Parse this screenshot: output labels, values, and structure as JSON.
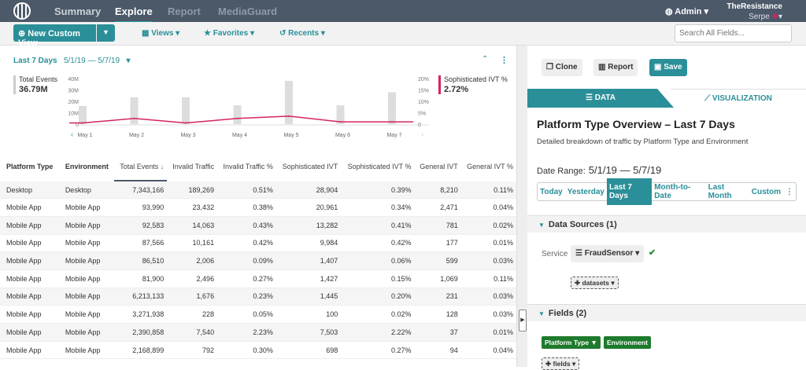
{
  "nav": {
    "items": [
      "Summary",
      "Explore",
      "Report",
      "MediaGuard"
    ],
    "active": "Explore",
    "user": "Admin",
    "org": "TheResistance",
    "sub_user": "Serpe"
  },
  "toolbar": {
    "new_view": "New Custom View",
    "views": "Views",
    "favorites": "Favorites",
    "recents": "Recents",
    "search_placeholder": "Search All Fields..."
  },
  "date": {
    "preset": "Last 7 Days",
    "range": "5/1/19 — 5/7/19"
  },
  "stats": {
    "total_label": "Total Events",
    "total_value": "36.79M",
    "ivt_label": "Sophisticated IVT %",
    "ivt_value": "2.72%"
  },
  "colors": {
    "accent": "#2a8f98",
    "line": "#d6245b",
    "bar": "#dddddd",
    "nav_bg": "#4b5969",
    "chip": "#1e7a2c"
  },
  "chart_data": {
    "type": "bar+line",
    "categories": [
      "May 1",
      "May 2",
      "May 3",
      "May 4",
      "May 5",
      "May 6",
      "May 7"
    ],
    "series": [
      {
        "name": "Total Events",
        "type": "bar",
        "axis": "left",
        "values": [
          16000000,
          23500000,
          23500000,
          16500000,
          38000000,
          16500000,
          28000000
        ]
      },
      {
        "name": "Sophisticated IVT %",
        "type": "line",
        "axis": "right",
        "values": [
          0.5,
          2.5,
          0.5,
          2.5,
          3.5,
          1,
          1
        ]
      }
    ],
    "left_ticks": [
      "0",
      "10M",
      "20M",
      "30M",
      "40M"
    ],
    "right_ticks": [
      "0",
      "5%",
      "10%",
      "15%",
      "20%"
    ],
    "ylim_left": [
      0,
      40000000
    ],
    "ylim_right": [
      0,
      20
    ]
  },
  "table": {
    "columns": [
      "Platform Type",
      "Environment",
      "Total Events",
      "Invalid Traffic",
      "Invalid Traffic %",
      "Sophisticated IVT",
      "Sophisticated IVT %",
      "General IVT",
      "General IVT %"
    ],
    "rows": [
      [
        "Desktop",
        "Desktop",
        "7,343,166",
        "189,269",
        "0.51%",
        "28,904",
        "0.39%",
        "8,210",
        "0.11%"
      ],
      [
        "Mobile App",
        "Mobile App",
        "93,990",
        "23,432",
        "0.38%",
        "20,961",
        "0.34%",
        "2,471",
        "0.04%"
      ],
      [
        "Mobile App",
        "Mobile App",
        "92,583",
        "14,063",
        "0.43%",
        "13,282",
        "0.41%",
        "781",
        "0.02%"
      ],
      [
        "Mobile App",
        "Mobile App",
        "87,566",
        "10,161",
        "0.42%",
        "9,984",
        "0.42%",
        "177",
        "0.01%"
      ],
      [
        "Mobile App",
        "Mobile App",
        "86,510",
        "2,006",
        "0.09%",
        "1,407",
        "0.06%",
        "599",
        "0.03%"
      ],
      [
        "Mobile App",
        "Mobile App",
        "81,900",
        "2,496",
        "0.27%",
        "1,427",
        "0.15%",
        "1,069",
        "0.11%"
      ],
      [
        "Mobile App",
        "Mobile App",
        "6,213,133",
        "1,676",
        "0.23%",
        "1,445",
        "0.20%",
        "231",
        "0.03%"
      ],
      [
        "Mobile App",
        "Mobile App",
        "3,271,938",
        "228",
        "0.05%",
        "100",
        "0.02%",
        "128",
        "0.03%"
      ],
      [
        "Mobile App",
        "Mobile App",
        "2,390,858",
        "7,540",
        "2.23%",
        "7,503",
        "2.22%",
        "37",
        "0.01%"
      ],
      [
        "Mobile App",
        "Mobile App",
        "2,168,899",
        "792",
        "0.30%",
        "698",
        "0.27%",
        "94",
        "0.04%"
      ]
    ]
  },
  "panel": {
    "clone": "Clone",
    "report": "Report",
    "save": "Save",
    "tab_data": "DATA",
    "tab_vis": "VISUALIZATION",
    "title": "Platform Type Overview – Last 7 Days",
    "description": "Detailed breakdown of traffic by Platform Type and Environment",
    "date_label": "Date Range:",
    "date_value": "5/1/19 — 5/7/19",
    "presets": [
      "Today",
      "Yesterday",
      "Last 7 Days",
      "Month-to-Date",
      "Last Month",
      "Custom"
    ],
    "active_preset": "Last 7 Days",
    "sources_header": "Data Sources (1)",
    "service_label": "Service",
    "service_value": "FraudSensor",
    "datasets": "datasets",
    "fields_header": "Fields (2)",
    "fields": [
      "Platform Type",
      "Environment"
    ],
    "add_fields": "fields"
  }
}
